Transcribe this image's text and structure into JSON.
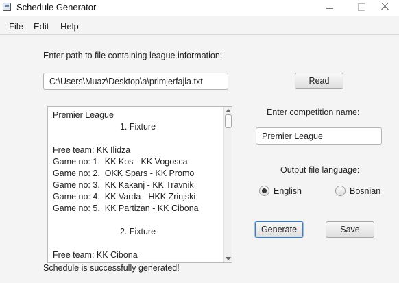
{
  "window": {
    "title": "Schedule Generator"
  },
  "menu": {
    "file": "File",
    "edit": "Edit",
    "help": "Help"
  },
  "path_prompt": "Enter path to file containing league information:",
  "path_value": "C:\\Users\\Muaz\\Desktop\\a\\primjerfajla.txt",
  "read_button": "Read",
  "competition_prompt": "Enter competition name:",
  "competition_value": "Premier League",
  "language_prompt": "Output file language:",
  "language_options": {
    "english": "English",
    "bosnian": "Bosnian",
    "selected": "English"
  },
  "generate_button": "Generate",
  "save_button": "Save",
  "schedule_lines": [
    "Premier League",
    "1. Fixture",
    "",
    "Free team: KK Ilidza",
    "Game no: 1.  KK Kos - KK Vogosca",
    "Game no: 2.  OKK Spars - KK Promo",
    "Game no: 3.  KK Kakanj - KK Travnik",
    "Game no: 4.  KK Varda - HKK Zrinjski",
    "Game no: 5.  KK Partizan - KK Cibona",
    "",
    "2. Fixture",
    "",
    "Free team: KK Cibona"
  ],
  "status_message": "Schedule is successfully generated!"
}
